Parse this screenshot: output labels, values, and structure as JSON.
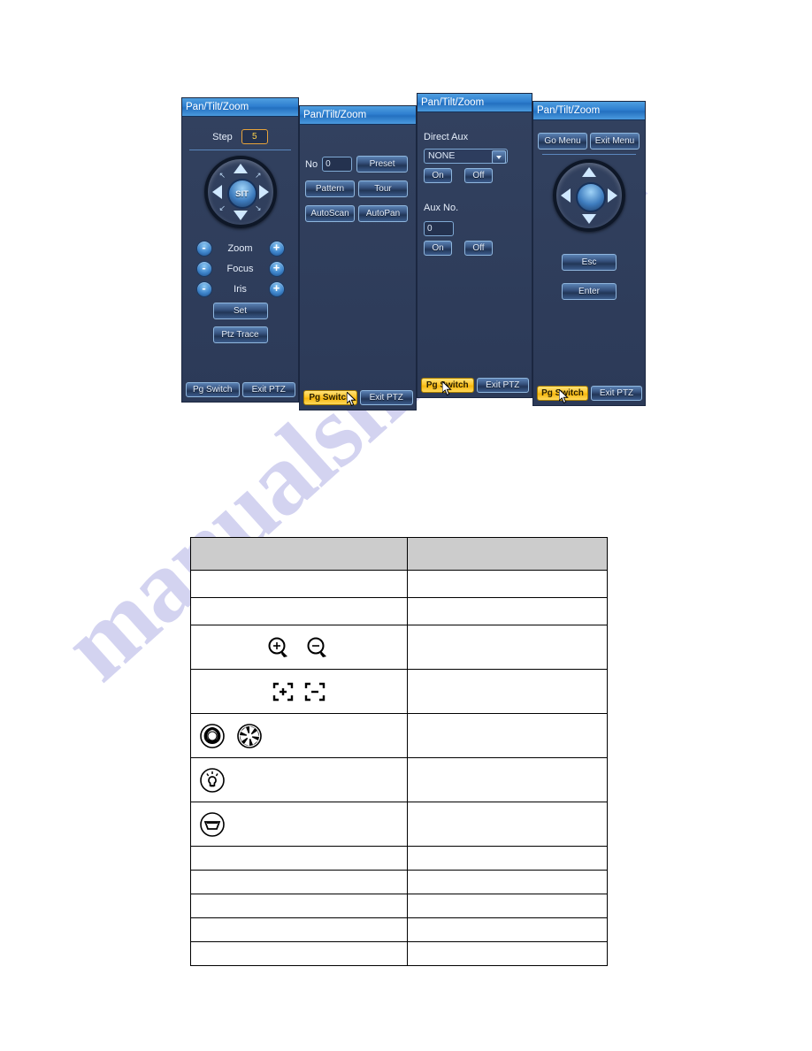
{
  "watermark": {
    "text": "manualshive.com",
    "color": "#b9b9e8"
  },
  "colors": {
    "panel_bg": "#2b3a5c",
    "title_blue": "#2f7fd0",
    "highlight_gold": "#ffc629",
    "button_border": "#8fb6dd",
    "focus_orange": "#e8a33a",
    "table_header_gray": "#cccccc"
  },
  "panels": [
    {
      "title": "Pan/Tilt/Zoom",
      "step_label": "Step",
      "step_value": "5",
      "joystick_center": "SIT",
      "controls": [
        {
          "minus": "-",
          "label": "Zoom",
          "plus": "+"
        },
        {
          "minus": "-",
          "label": "Focus",
          "plus": "+"
        },
        {
          "minus": "-",
          "label": "Iris",
          "plus": "+"
        }
      ],
      "set_label": "Set",
      "ptz_trace_label": "Ptz Trace",
      "pg_switch_label": "Pg Switch",
      "exit_ptz_label": "Exit PTZ"
    },
    {
      "title": "Pan/Tilt/Zoom",
      "no_label": "No",
      "no_value": "0",
      "preset_label": "Preset",
      "pattern_label": "Pattern",
      "tour_label": "Tour",
      "autoscan_label": "AutoScan",
      "autopan_label": "AutoPan",
      "pg_switch_label": "Pg Switch",
      "exit_ptz_label": "Exit PTZ"
    },
    {
      "title": "Pan/Tilt/Zoom",
      "direct_aux_label": "Direct Aux",
      "direct_aux_value": "NONE",
      "direct_on_label": "On",
      "direct_off_label": "Off",
      "aux_no_label": "Aux No.",
      "aux_no_value": "0",
      "aux_on_label": "On",
      "aux_off_label": "Off",
      "pg_switch_label": "Pg Switch",
      "exit_ptz_label": "Exit PTZ"
    },
    {
      "title": "Pan/Tilt/Zoom",
      "go_menu_label": "Go Menu",
      "exit_menu_label": "Exit Menu",
      "esc_label": "Esc",
      "enter_label": "Enter",
      "pg_switch_label": "Pg Switch",
      "exit_ptz_label": "Exit PTZ"
    }
  ],
  "table": {
    "header": {
      "col1": "",
      "col2": ""
    },
    "rows": [
      {
        "col1": "",
        "col2": "",
        "icons": []
      },
      {
        "col1": "",
        "col2": "",
        "icons": []
      },
      {
        "col1": "",
        "col2": "",
        "icons": [
          "zoom-in-magnifier-icon",
          "zoom-out-magnifier-icon"
        ]
      },
      {
        "col1": "",
        "col2": "",
        "icons": [
          "focus-near-bracket-icon",
          "focus-far-bracket-icon"
        ]
      },
      {
        "col1": "",
        "col2": "",
        "icons": [
          "iris-open-aperture-icon",
          "iris-close-aperture-icon"
        ]
      },
      {
        "col1": "",
        "col2": "",
        "icons": [
          "light-bulb-icon"
        ]
      },
      {
        "col1": "",
        "col2": "",
        "icons": [
          "wiper-icon"
        ]
      },
      {
        "col1": "",
        "col2": "",
        "icons": []
      },
      {
        "col1": "",
        "col2": "",
        "icons": []
      },
      {
        "col1": "",
        "col2": "",
        "icons": []
      },
      {
        "col1": "",
        "col2": "",
        "icons": []
      },
      {
        "col1": "",
        "col2": "",
        "icons": []
      }
    ]
  }
}
